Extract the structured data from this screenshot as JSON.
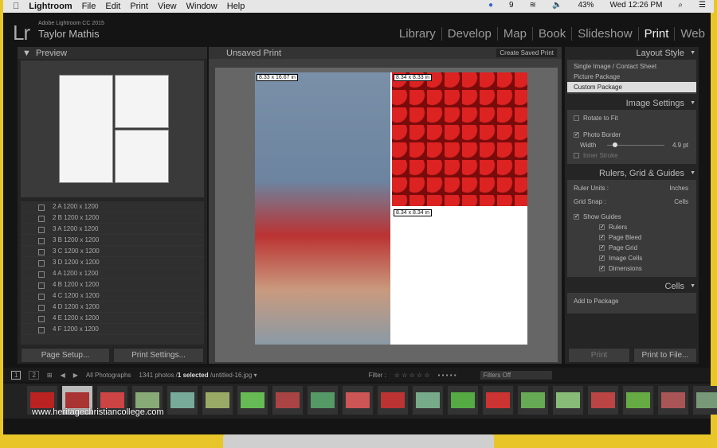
{
  "menubar": {
    "app": "Lightroom",
    "items": [
      "File",
      "Edit",
      "Print",
      "View",
      "Window",
      "Help"
    ],
    "status": {
      "cc_count": "9",
      "battery": "43%",
      "time": "Wed 12:26 PM"
    }
  },
  "header": {
    "logo": "Lr",
    "product": "Adobe Lightroom CC 2015",
    "user": "Taylor Mathis",
    "modules": [
      "Library",
      "Develop",
      "Map",
      "Book",
      "Slideshow",
      "Print",
      "Web"
    ],
    "active_module": "Print"
  },
  "left": {
    "preview_title": "Preview",
    "templates": [
      "2 A 1200 x 1200",
      "2 B 1200 x 1200",
      "3 A 1200 x 1200",
      "3 B 1200 x 1200",
      "3 C 1200 x 1200",
      "3 D 1200 x 1200",
      "4 A 1200 x 1200",
      "4 B 1200 x 1200",
      "4 C 1200 x 1200",
      "4 D 1200 x 1200",
      "4 E 1200 x 1200",
      "4 F 1200 x 1200"
    ],
    "page_setup": "Page Setup...",
    "print_settings": "Print Settings..."
  },
  "center": {
    "title": "Unsaved Print",
    "create_saved": "Create Saved Print",
    "cells": [
      "8.33 x 16.67 in",
      "8.34 x 8.33 in",
      "8.34 x 8.34 in"
    ]
  },
  "right": {
    "layout_style": {
      "title": "Layout Style",
      "options": [
        "Single Image / Contact Sheet",
        "Picture Package",
        "Custom Package"
      ],
      "selected": "Custom Package"
    },
    "image_settings": {
      "title": "Image Settings",
      "rotate": "Rotate to Fit",
      "photo_border": "Photo Border",
      "width_label": "Width",
      "width_value": "4.9",
      "unit": "pt",
      "inner_stroke": "Inner Stroke",
      "border_fraction": 0.1
    },
    "rulers": {
      "title": "Rulers, Grid & Guides",
      "ruler_units_label": "Ruler Units :",
      "ruler_units": "Inches",
      "grid_snap_label": "Grid Snap :",
      "grid_snap": "Cells",
      "show_guides": "Show Guides",
      "guides": [
        "Rulers",
        "Page Bleed",
        "Page Grid",
        "Image Cells",
        "Dimensions"
      ]
    },
    "cells": {
      "title": "Cells",
      "add": "Add to Package"
    },
    "print": "Print",
    "print_to_file": "Print to File..."
  },
  "filmbar": {
    "pages": [
      "1",
      "2"
    ],
    "source": "All Photographs",
    "count": "1341 photos /",
    "selected": "1 selected",
    "file": "/untitled-16.jpg",
    "filter_label": "Filter :",
    "filters_off": "Filters Off"
  },
  "watermark": "www.heritagechristiancollege.com"
}
